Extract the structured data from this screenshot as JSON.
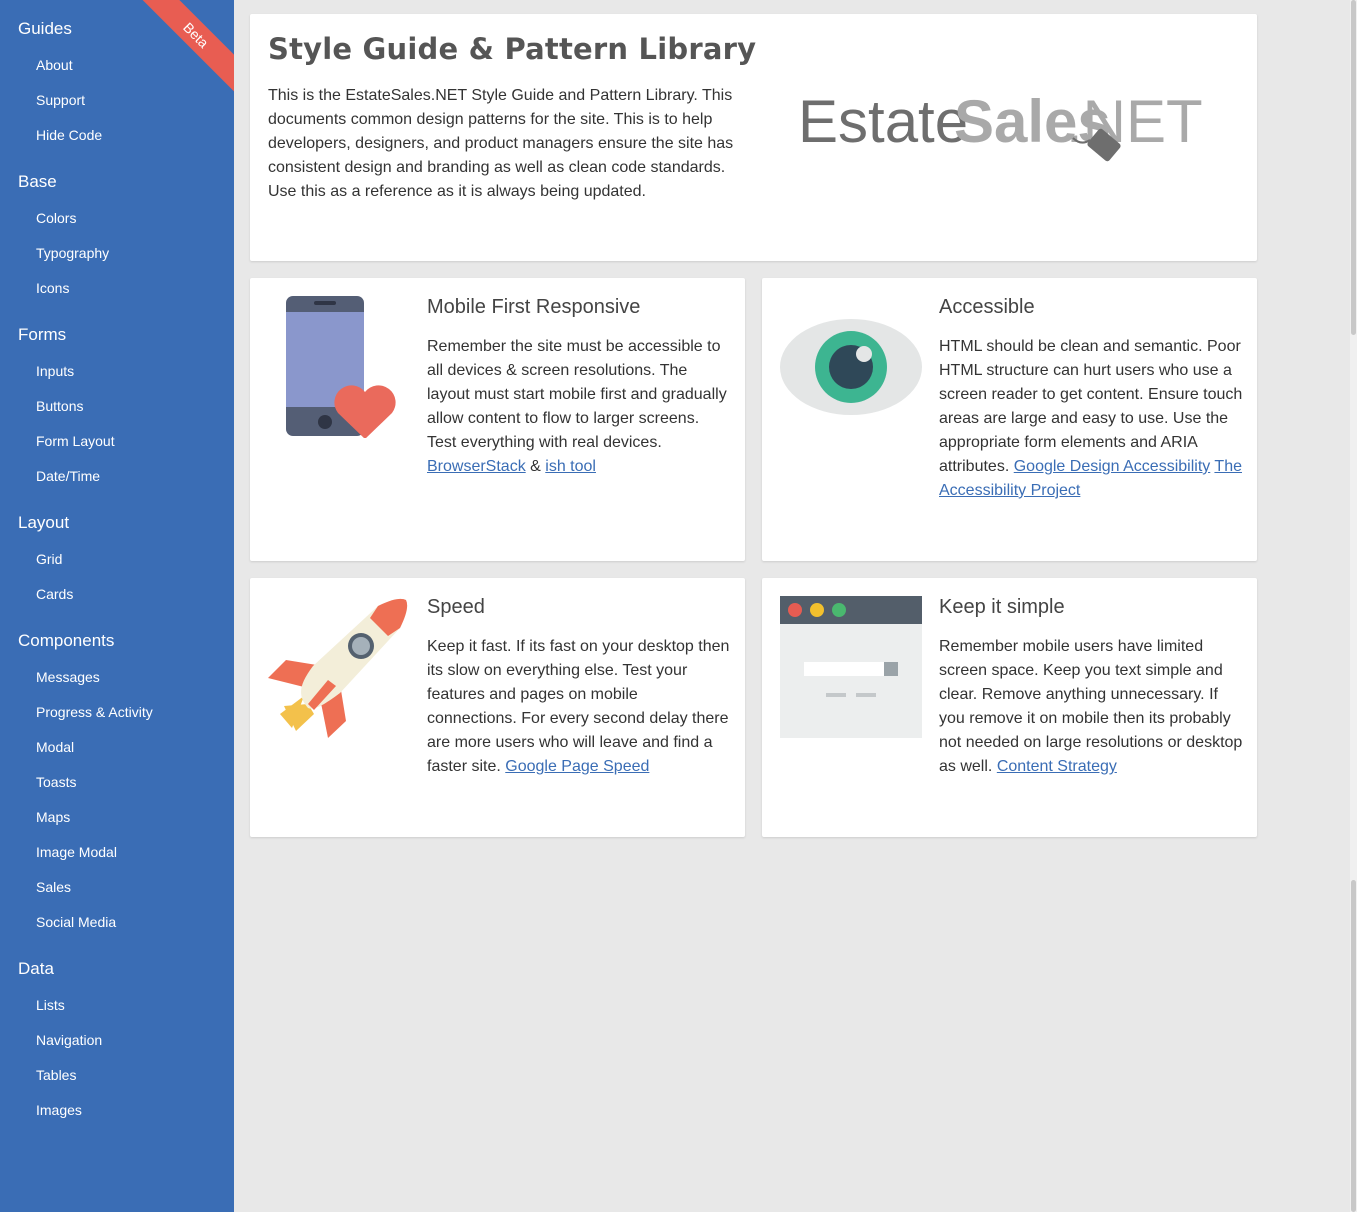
{
  "colors": {
    "sidebar": "#3a6db5",
    "ribbon": "#e85d52",
    "link": "#3a6db5",
    "background": "#e8e8e8"
  },
  "ribbon": {
    "label": "Beta"
  },
  "sidebar": {
    "groups": [
      {
        "heading": "Guides",
        "items": [
          "About",
          "Support",
          "Hide Code"
        ]
      },
      {
        "heading": "Base",
        "items": [
          "Colors",
          "Typography",
          "Icons"
        ]
      },
      {
        "heading": "Forms",
        "items": [
          "Inputs",
          "Buttons",
          "Form Layout",
          "Date/Time"
        ]
      },
      {
        "heading": "Layout",
        "items": [
          "Grid",
          "Cards"
        ]
      },
      {
        "heading": "Components",
        "items": [
          "Messages",
          "Progress & Activity",
          "Modal",
          "Toasts",
          "Maps",
          "Image Modal",
          "Sales",
          "Social Media"
        ]
      },
      {
        "heading": "Data",
        "items": [
          "Lists",
          "Navigation",
          "Tables",
          "Images"
        ]
      }
    ]
  },
  "hero": {
    "title": "Style Guide & Pattern Library",
    "body": "This is the EstateSales.NET Style Guide and Pattern Library. This documents common design patterns for the site. This is to help developers, designers, and product managers ensure the site has consistent design and branding as well as clean code standards. Use this as a reference as it is always being updated.",
    "logo": {
      "part1": "Estate",
      "part2": "Sales",
      "part3": ".NET"
    }
  },
  "features": {
    "mobile": {
      "icon": "phone-heart-icon",
      "title": "Mobile First Responsive",
      "text": "Remember the site must be accessible to all devices & screen resolutions. The layout must start mobile first and gradually allow content to flow to larger screens. Test everything with real devices.",
      "link1": "BrowserStack",
      "sep": "&",
      "link2": "ish tool"
    },
    "accessible": {
      "icon": "eye-icon",
      "title": "Accessible",
      "text": "HTML should be clean and semantic. Poor HTML structure can hurt users who use a screen reader to get content. Ensure touch areas are large and easy to use. Use the appropriate form elements and ARIA attributes.",
      "link1": "Google Design Accessibility",
      "link2": "The Accessibility Project"
    },
    "speed": {
      "icon": "rocket-icon",
      "title": "Speed",
      "text": "Keep it fast. If its fast on your desktop then its slow on everything else. Test your features and pages on mobile connections. For every second delay there are more users who will leave and find a faster site.",
      "link1": "Google Page Speed"
    },
    "simple": {
      "icon": "browser-window-icon",
      "title": "Keep it simple",
      "text": "Remember mobile users have limited screen space. Keep you text simple and clear. Remove anything unnecessary. If you remove it on mobile then its probably not needed on large resolutions or desktop as well.",
      "link1": "Content Strategy"
    }
  }
}
